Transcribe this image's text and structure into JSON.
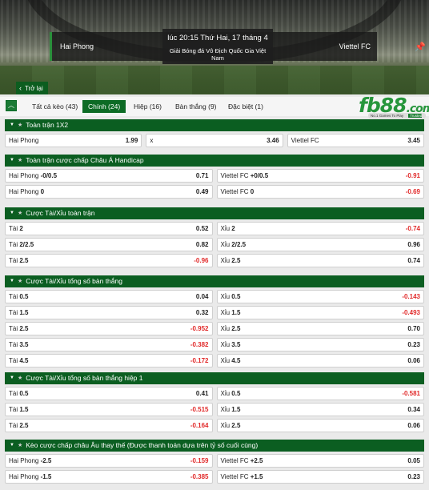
{
  "match": {
    "home": "Hai Phong",
    "away": "Viettel FC",
    "time": "lúc 20:15 Thứ Hai, 17 tháng 4",
    "league": "Giải Bóng đá Vô Địch Quốc Gia Việt Nam"
  },
  "back_label": "Trở lại",
  "tabs": [
    {
      "label": "Tất cả kèo (43)",
      "active": false
    },
    {
      "label": "Chính (24)",
      "active": true
    },
    {
      "label": "Hiệp (16)",
      "active": false
    },
    {
      "label": "Bàn thắng (9)",
      "active": false
    },
    {
      "label": "Đặc biệt (1)",
      "active": false
    }
  ],
  "logo": {
    "text": "fb88",
    "dotcom": ".com",
    "tagline": "No.1 Games To Play",
    "badge": "Trusted Place To Bet"
  },
  "colors": {
    "primary": "#0b5e21",
    "negative": "#e12a2a",
    "logo": "#27963c"
  },
  "sections": [
    {
      "title": "Toàn trận 1X2",
      "rows": [
        [
          {
            "name": "Hai Phong",
            "handicap": "",
            "odd": "1.99"
          },
          {
            "name": "x",
            "handicap": "",
            "odd": "3.46"
          },
          {
            "name": "Viettel FC",
            "handicap": "",
            "odd": "3.45"
          }
        ]
      ]
    },
    {
      "title": "Toàn trận cược chấp Châu Á Handicap",
      "rows": [
        [
          {
            "name": "Hai Phong",
            "handicap": "-0/0.5",
            "odd": "0.71"
          },
          {
            "name": "Viettel FC",
            "handicap": "+0/0.5",
            "odd": "-0.91"
          }
        ],
        [
          {
            "name": "Hai Phong",
            "handicap": "0",
            "odd": "0.49"
          },
          {
            "name": "Viettel FC",
            "handicap": "0",
            "odd": "-0.69"
          }
        ]
      ]
    },
    {
      "title": "Cược Tài/Xỉu toàn trận",
      "rows": [
        [
          {
            "name": "Tài",
            "handicap": "2",
            "odd": "0.52"
          },
          {
            "name": "Xỉu",
            "handicap": "2",
            "odd": "-0.74"
          }
        ],
        [
          {
            "name": "Tài",
            "handicap": "2/2.5",
            "odd": "0.82"
          },
          {
            "name": "Xỉu",
            "handicap": "2/2.5",
            "odd": "0.96"
          }
        ],
        [
          {
            "name": "Tài",
            "handicap": "2.5",
            "odd": "-0.96"
          },
          {
            "name": "Xỉu",
            "handicap": "2.5",
            "odd": "0.74"
          }
        ]
      ]
    },
    {
      "title": "Cược Tài/Xỉu tổng số bàn thắng",
      "rows": [
        [
          {
            "name": "Tài",
            "handicap": "0.5",
            "odd": "0.04"
          },
          {
            "name": "Xỉu",
            "handicap": "0.5",
            "odd": "-0.143"
          }
        ],
        [
          {
            "name": "Tài",
            "handicap": "1.5",
            "odd": "0.32"
          },
          {
            "name": "Xỉu",
            "handicap": "1.5",
            "odd": "-0.493"
          }
        ],
        [
          {
            "name": "Tài",
            "handicap": "2.5",
            "odd": "-0.952"
          },
          {
            "name": "Xỉu",
            "handicap": "2.5",
            "odd": "0.70"
          }
        ],
        [
          {
            "name": "Tài",
            "handicap": "3.5",
            "odd": "-0.382"
          },
          {
            "name": "Xỉu",
            "handicap": "3.5",
            "odd": "0.23"
          }
        ],
        [
          {
            "name": "Tài",
            "handicap": "4.5",
            "odd": "-0.172"
          },
          {
            "name": "Xỉu",
            "handicap": "4.5",
            "odd": "0.06"
          }
        ]
      ]
    },
    {
      "title": "Cược Tài/Xỉu tổng số bàn thắng hiệp 1",
      "rows": [
        [
          {
            "name": "Tài",
            "handicap": "0.5",
            "odd": "0.41"
          },
          {
            "name": "Xỉu",
            "handicap": "0.5",
            "odd": "-0.581"
          }
        ],
        [
          {
            "name": "Tài",
            "handicap": "1.5",
            "odd": "-0.515"
          },
          {
            "name": "Xỉu",
            "handicap": "1.5",
            "odd": "0.34"
          }
        ],
        [
          {
            "name": "Tài",
            "handicap": "2.5",
            "odd": "-0.164"
          },
          {
            "name": "Xỉu",
            "handicap": "2.5",
            "odd": "0.06"
          }
        ]
      ]
    },
    {
      "title": "Kèo cược chấp châu Âu thay thế (Được thanh toán dựa trên tỷ số cuối cùng)",
      "rows": [
        [
          {
            "name": "Hai Phong",
            "handicap": "-2.5",
            "odd": "-0.159"
          },
          {
            "name": "Viettel FC",
            "handicap": "+2.5",
            "odd": "0.05"
          }
        ],
        [
          {
            "name": "Hai Phong",
            "handicap": "-1.5",
            "odd": "-0.385"
          },
          {
            "name": "Viettel FC",
            "handicap": "+1.5",
            "odd": "0.23"
          }
        ]
      ]
    }
  ]
}
